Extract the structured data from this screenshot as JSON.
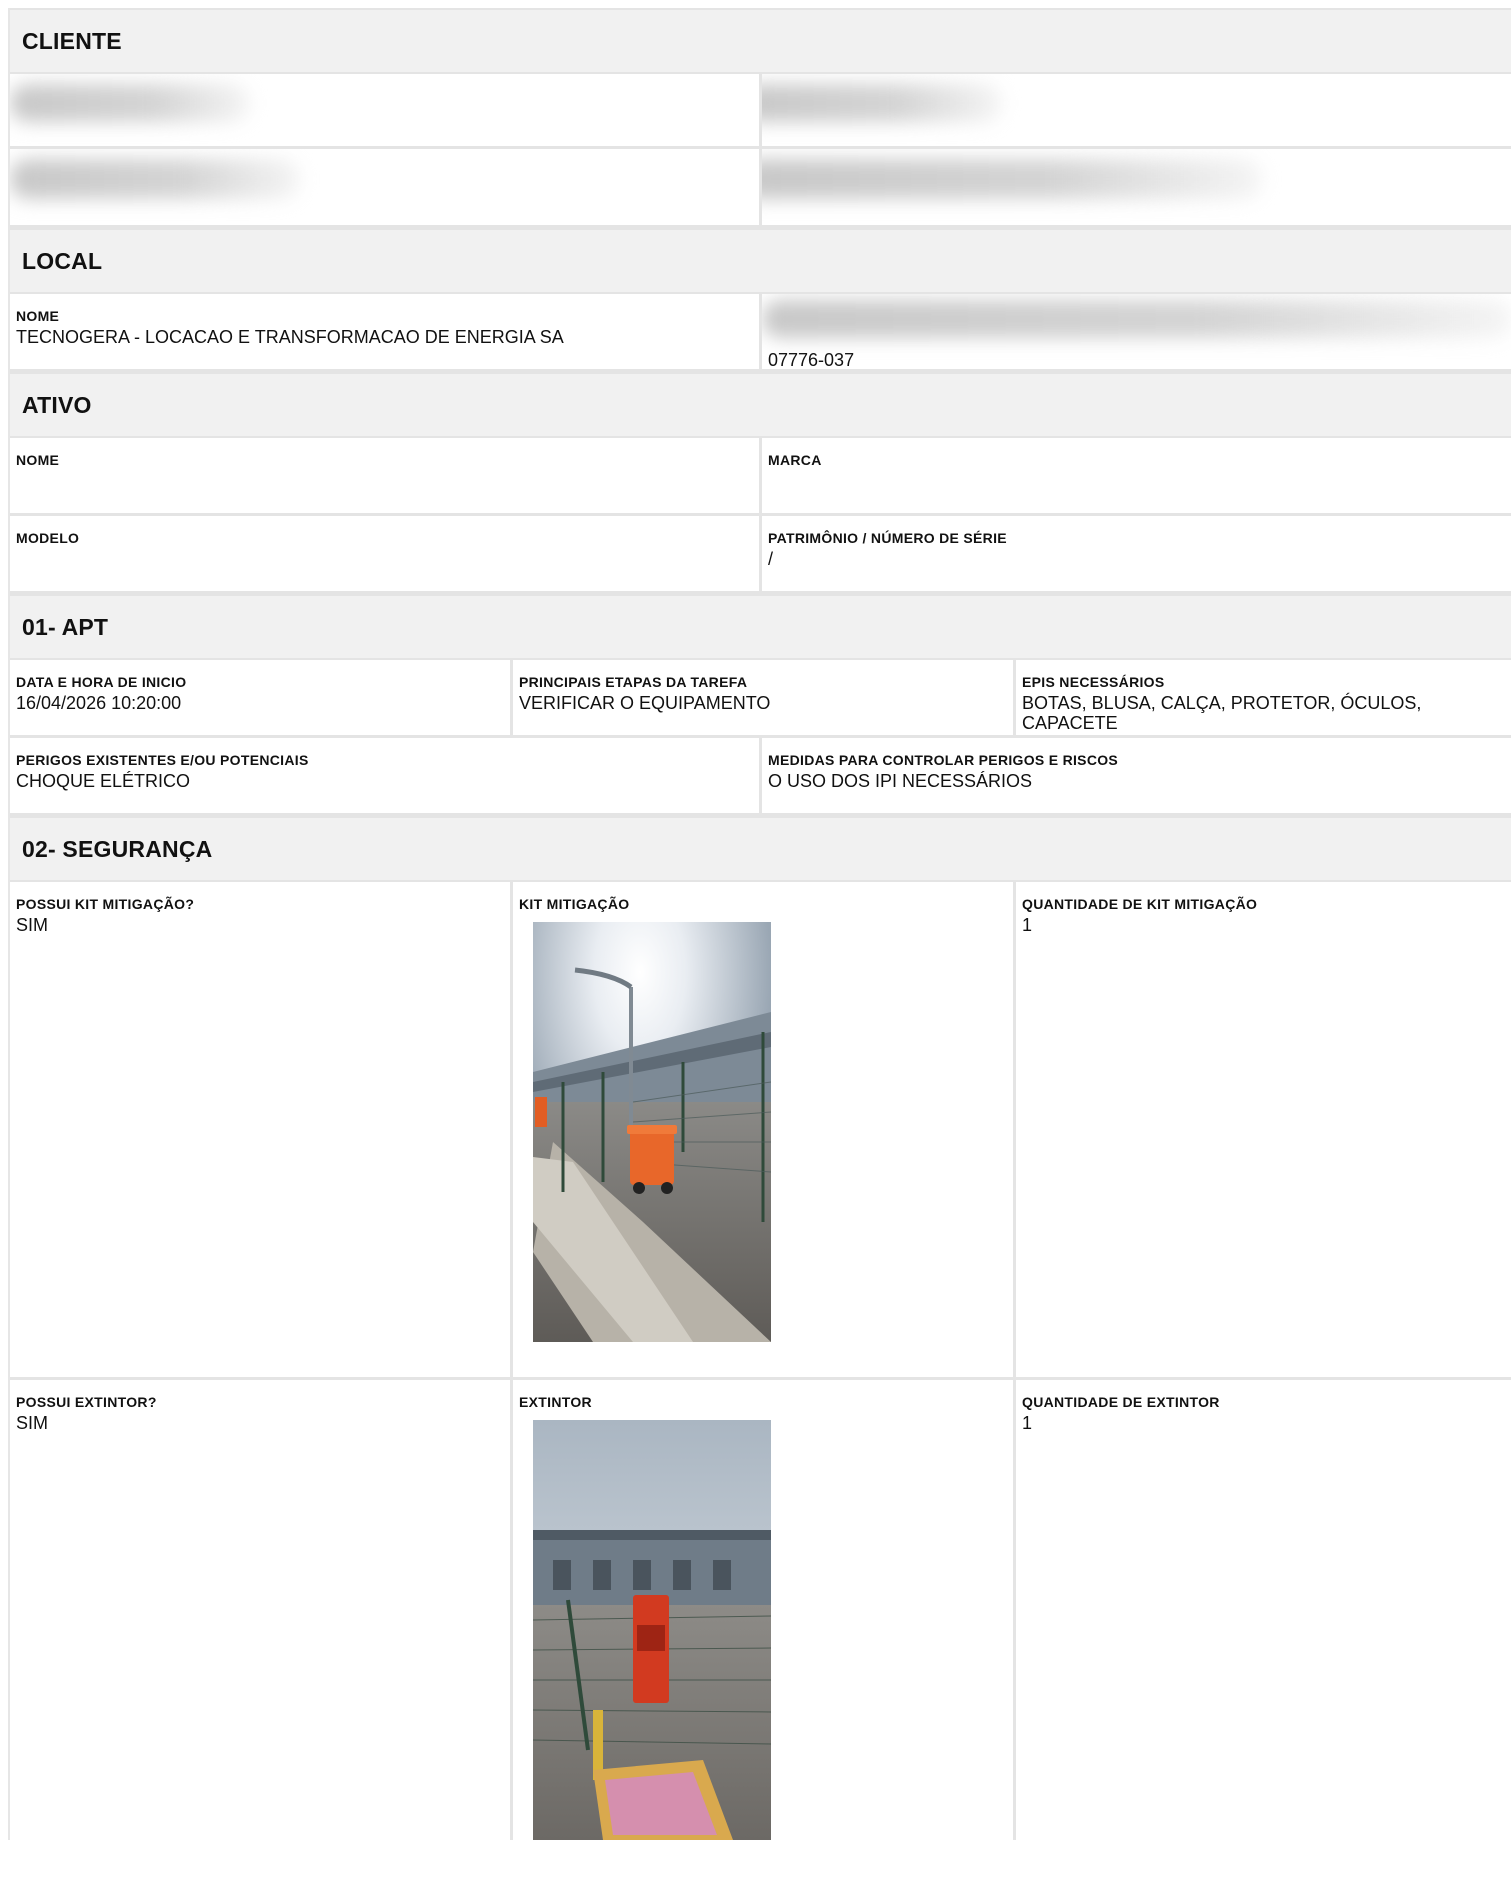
{
  "sections": {
    "cliente": "CLIENTE",
    "local": "LOCAL",
    "ativo": "ATIVO",
    "apt": "01- APT",
    "seguranca": "02- SEGURANÇA"
  },
  "local": {
    "nome_label": "NOME",
    "nome_value": "TECNOGERA - LOCACAO E TRANSFORMACAO DE ENERGIA SA",
    "cep_value": "07776-037"
  },
  "ativo": {
    "nome_label": "NOME",
    "marca_label": "MARCA",
    "modelo_label": "MODELO",
    "patrimonio_label": "PATRIMÔNIO / NÚMERO DE SÉRIE",
    "patrimonio_value": "/"
  },
  "apt": {
    "data_label": "DATA E HORA DE INICIO",
    "data_value": "16/04/2026 10:20:00",
    "etapas_label": "PRINCIPAIS ETAPAS DA TAREFA",
    "etapas_value": "VERIFICAR O EQUIPAMENTO",
    "epis_label": "EPIS NECESSÁRIOS",
    "epis_value": "BOTAS, BLUSA, CALÇA, PROTETOR, ÓCULOS, CAPACETE",
    "perigos_label": "PERIGOS EXISTENTES E/OU POTENCIAIS",
    "perigos_value": "CHOQUE ELÉTRICO",
    "medidas_label": "MEDIDAS PARA CONTROLAR PERIGOS E RISCOS",
    "medidas_value": "O USO DOS IPI NECESSÁRIOS"
  },
  "seguranca": {
    "possui_kit_label": "POSSUI KIT MITIGAÇÃO?",
    "possui_kit_value": "SIM",
    "kit_label": "KIT MITIGAÇÃO",
    "qtd_kit_label": "QUANTIDADE DE KIT MITIGAÇÃO",
    "qtd_kit_value": "1",
    "possui_extintor_label": "POSSUI EXTINTOR?",
    "possui_extintor_value": "SIM",
    "extintor_label": "EXTINTOR",
    "qtd_extintor_label": "QUANTIDADE DE EXTINTOR",
    "qtd_extintor_value": "1"
  }
}
